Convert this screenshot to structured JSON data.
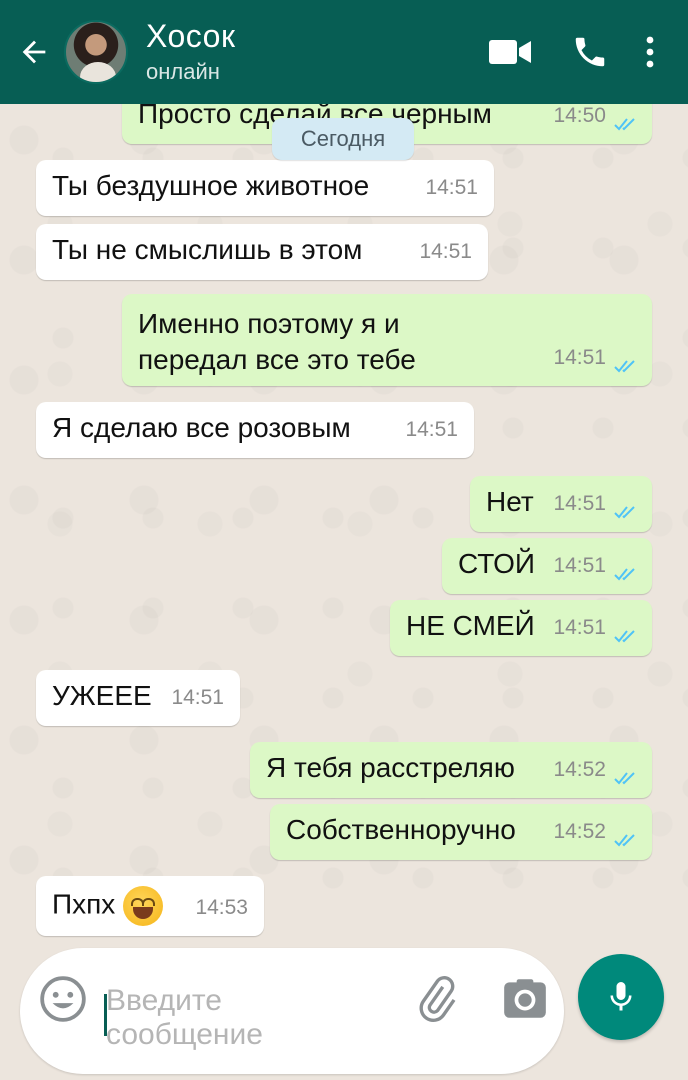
{
  "header": {
    "contact_name": "Хосок",
    "status": "онлайн",
    "icons": [
      "back-arrow-icon",
      "video-call-icon",
      "phone-icon",
      "more-vert-icon"
    ]
  },
  "chat": {
    "date_label": "Сегодня",
    "messages": [
      {
        "dir": "out",
        "text": "Просто сделай все черным",
        "time": "14:50",
        "read": true
      },
      {
        "dir": "in",
        "text": "Ты бездушное животное",
        "time": "14:51"
      },
      {
        "dir": "in",
        "text": "Ты не смыслишь в этом",
        "time": "14:51"
      },
      {
        "dir": "out",
        "text": "Именно поэтому я и передал все это тебе",
        "line1": "Именно поэтому я и",
        "line2": "передал все это тебе",
        "time": "14:51",
        "read": true
      },
      {
        "dir": "in",
        "text": "Я сделаю все розовым",
        "time": "14:51"
      },
      {
        "dir": "out",
        "text": "Нет",
        "time": "14:51",
        "read": true
      },
      {
        "dir": "out",
        "text": "СТОЙ",
        "time": "14:51",
        "read": true
      },
      {
        "dir": "out",
        "text": "НЕ СМЕЙ",
        "time": "14:51",
        "read": true
      },
      {
        "dir": "in",
        "text": "УЖЕЕЕ",
        "time": "14:51"
      },
      {
        "dir": "out",
        "text": "Я тебя расстреляю",
        "time": "14:52",
        "read": true
      },
      {
        "dir": "out",
        "text": "Собственноручно",
        "time": "14:52",
        "read": true
      },
      {
        "dir": "in",
        "text": "Пхпх",
        "emoji": "grinning-squinting-face",
        "time": "14:53"
      }
    ]
  },
  "input": {
    "placeholder_line1": "Введите",
    "placeholder_line2": "сообщение"
  },
  "colors": {
    "header": "#075e54",
    "outgoing_bubble": "#dcf8c6",
    "incoming_bubble": "#ffffff",
    "read_ticks": "#4fc3f7",
    "mic_button": "#00897b",
    "chat_background": "#ece5dd"
  }
}
